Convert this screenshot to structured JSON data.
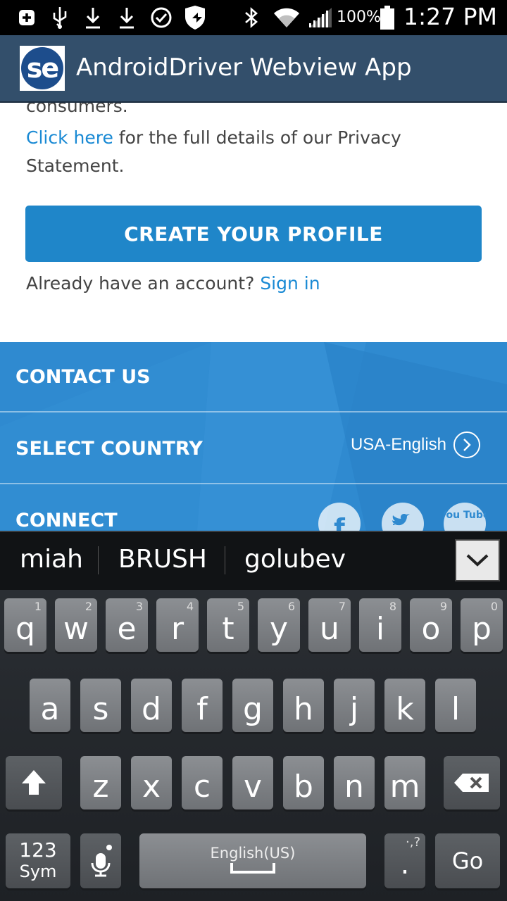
{
  "status_bar": {
    "battery_pct": "100%",
    "time": "1:27 PM",
    "icons": [
      "notification-plus-icon",
      "usb-icon",
      "download-icon",
      "download-icon",
      "check-circle-icon",
      "shield-icon",
      "bluetooth-icon",
      "wifi-icon",
      "signal-icon",
      "battery-icon"
    ]
  },
  "app_bar": {
    "logo_text": "se",
    "title": "AndroidDriver Webview App"
  },
  "webview": {
    "consumers_text": "consumers.",
    "click_here": "Click here",
    "privacy_rest": " for the full details of our Privacy Statement.",
    "create_profile": "CREATE YOUR PROFILE",
    "already_text": "Already have an account? ",
    "sign_in": "Sign in"
  },
  "footer": {
    "contact_us": "CONTACT US",
    "select_country": "SELECT COUNTRY",
    "country_value": "USA-English",
    "connect": "CONNECT",
    "youtube_text": "You Tube"
  },
  "keyboard": {
    "suggestions": [
      "miah",
      "BRUSH",
      "golubev"
    ],
    "row1": [
      [
        "q",
        "1"
      ],
      [
        "w",
        "2"
      ],
      [
        "e",
        "3"
      ],
      [
        "r",
        "4"
      ],
      [
        "t",
        "5"
      ],
      [
        "y",
        "6"
      ],
      [
        "u",
        "7"
      ],
      [
        "i",
        "8"
      ],
      [
        "o",
        "9"
      ],
      [
        "p",
        "0"
      ]
    ],
    "row2": [
      "a",
      "s",
      "d",
      "f",
      "g",
      "h",
      "j",
      "k",
      "l"
    ],
    "row3": [
      "z",
      "x",
      "c",
      "v",
      "b",
      "n",
      "m"
    ],
    "sym_top": "123",
    "sym_bottom": "Sym",
    "space_label": "English(US)",
    "period": ".",
    "period_hint": "·,?",
    "go": "Go"
  }
}
